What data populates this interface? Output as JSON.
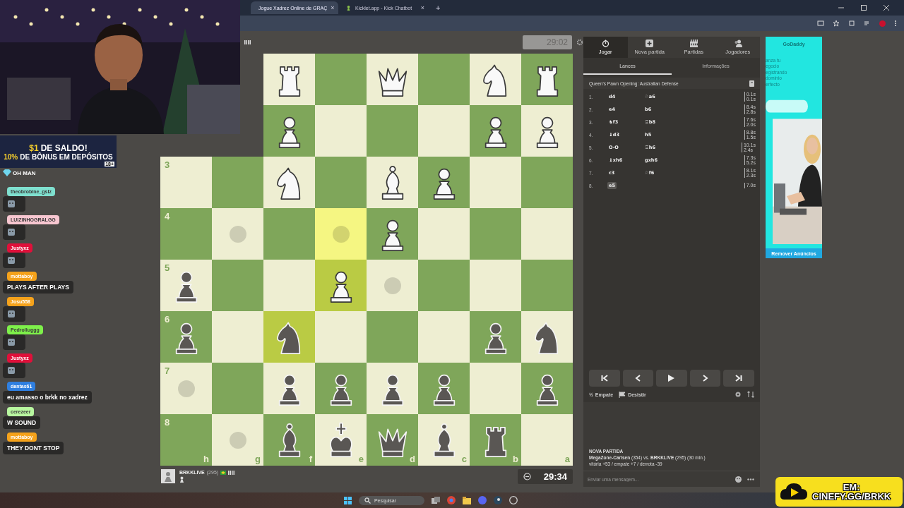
{
  "browser": {
    "tabs": [
      {
        "title": "Jogue Xadrez Online de GRAÇ",
        "selected": true,
        "close": "×"
      },
      {
        "title": "Kicklet.app - Kick Chatbot",
        "selected": false,
        "close": "×"
      }
    ],
    "new_tab": "+"
  },
  "board": {
    "clock": "29:02",
    "rows": [
      {
        "squares": [
          {
            "kind": "rook",
            "color": "#f9f9f9",
            "hint": false,
            "highlight": false
          },
          {
            "hint": false,
            "highlight": false
          },
          {
            "kind": "queen",
            "color": "#f9f9f9",
            "hint": false,
            "highlight": false
          },
          {
            "hint": false,
            "highlight": false
          },
          {
            "kind": "knight",
            "color": "#f9f9f9",
            "hint": false,
            "highlight": false
          },
          {
            "kind": "rook",
            "color": "#f9f9f9",
            "hint": false,
            "highlight": false
          }
        ]
      },
      {
        "squares": [
          {
            "kind": "pawn",
            "color": "#f9f9f9",
            "hint": false,
            "highlight": false
          },
          {
            "hint": false,
            "highlight": false
          },
          {
            "hint": false,
            "highlight": false
          },
          {
            "hint": false,
            "highlight": false
          },
          {
            "kind": "pawn",
            "color": "#f9f9f9",
            "hint": false,
            "highlight": false
          },
          {
            "kind": "pawn",
            "color": "#f9f9f9",
            "hint": false,
            "highlight": false
          }
        ]
      },
      {
        "squares": [
          {
            "rank_label": "3",
            "hint": false,
            "highlight": false
          },
          {
            "hint": false,
            "highlight": false
          },
          {
            "kind": "knight",
            "color": "#f9f9f9",
            "hint": false,
            "highlight": false
          },
          {
            "hint": false,
            "highlight": false
          },
          {
            "kind": "bishop",
            "color": "#f9f9f9",
            "hint": false,
            "highlight": false
          },
          {
            "kind": "pawn",
            "color": "#f9f9f9",
            "hint": false,
            "highlight": false
          },
          {
            "hint": false,
            "highlight": false
          },
          {
            "hint": false,
            "highlight": false
          }
        ]
      },
      {
        "squares": [
          {
            "rank_label": "4",
            "hint": false,
            "highlight": false
          },
          {
            "hint": true,
            "highlight": false
          },
          {
            "hint": false,
            "highlight": false
          },
          {
            "hint": true,
            "highlight": true
          },
          {
            "kind": "pawn",
            "color": "#f9f9f9",
            "hint": false,
            "highlight": false
          },
          {
            "hint": false,
            "highlight": false
          },
          {
            "hint": false,
            "highlight": false
          },
          {
            "hint": false,
            "highlight": false
          }
        ]
      },
      {
        "squares": [
          {
            "rank_label": "5",
            "kind": "pawn",
            "color": "#5a5754",
            "hint": false,
            "highlight": false
          },
          {
            "hint": false,
            "highlight": false
          },
          {
            "hint": false,
            "highlight": false
          },
          {
            "kind": "pawn",
            "color": "#f9f9f9",
            "hint": false,
            "highlight": true
          },
          {
            "hint": true,
            "highlight": false
          },
          {
            "hint": false,
            "highlight": false
          },
          {
            "hint": false,
            "highlight": false
          },
          {
            "hint": false,
            "highlight": false
          }
        ]
      },
      {
        "squares": [
          {
            "rank_label": "6",
            "kind": "pawn",
            "color": "#5a5754",
            "hint": false,
            "highlight": false
          },
          {
            "hint": false,
            "highlight": false
          },
          {
            "kind": "knight",
            "color": "#5a5754",
            "hint": false,
            "highlight": true
          },
          {
            "hint": false,
            "highlight": false
          },
          {
            "hint": false,
            "highlight": false
          },
          {
            "hint": false,
            "highlight": false
          },
          {
            "kind": "pawn",
            "color": "#5a5754",
            "hint": false,
            "highlight": false
          },
          {
            "kind": "knight",
            "color": "#5a5754",
            "hint": false,
            "highlight": false
          }
        ]
      },
      {
        "squares": [
          {
            "rank_label": "7",
            "hint": true,
            "highlight": false
          },
          {
            "hint": false,
            "highlight": false
          },
          {
            "kind": "pawn",
            "color": "#5a5754",
            "hint": false,
            "highlight": false
          },
          {
            "kind": "pawn",
            "color": "#5a5754",
            "hint": false,
            "highlight": false
          },
          {
            "kind": "pawn",
            "color": "#5a5754",
            "hint": false,
            "highlight": false
          },
          {
            "kind": "pawn",
            "color": "#5a5754",
            "hint": false,
            "highlight": false
          },
          {
            "hint": false,
            "highlight": false
          },
          {
            "kind": "pawn",
            "color": "#5a5754",
            "hint": false,
            "highlight": false
          }
        ]
      },
      {
        "squares": [
          {
            "rank_label": "8",
            "file_label": "h",
            "hint": false,
            "highlight": false
          },
          {
            "file_label": "g",
            "hint": true,
            "highlight": false
          },
          {
            "file_label": "f",
            "kind": "bishop",
            "color": "#5a5754",
            "hint": false,
            "highlight": false
          },
          {
            "file_label": "e",
            "kind": "king",
            "color": "#5a5754",
            "hint": false,
            "highlight": false
          },
          {
            "file_label": "d",
            "kind": "queen",
            "color": "#5a5754",
            "hint": false,
            "highlight": false
          },
          {
            "file_label": "c",
            "kind": "bishop",
            "color": "#5a5754",
            "hint": false,
            "highlight": false
          },
          {
            "file_label": "b",
            "kind": "rook",
            "color": "#5a5754",
            "hint": false,
            "highlight": false
          },
          {
            "file_label": "a",
            "hint": false,
            "highlight": false
          }
        ]
      }
    ],
    "player": {
      "name": "BRKKLIVE",
      "rating": "(295)",
      "clock": "29:34"
    }
  },
  "panel": {
    "nav": [
      {
        "label": "Jogar",
        "kind": "clock",
        "selected": true
      },
      {
        "label": "Nova partida",
        "kind": "plus",
        "selected": false
      },
      {
        "label": "Partidas",
        "kind": "grid",
        "selected": false
      },
      {
        "label": "Jogadores",
        "kind": "people",
        "selected": false
      }
    ],
    "subtabs": [
      {
        "label": "Lances",
        "selected": true
      },
      {
        "label": "Informações",
        "selected": false
      }
    ],
    "opening": "Queen's Pawn Opening: Australian Defense",
    "moves": [
      {
        "num": "1.",
        "white": {
          "san": "d4",
          "selected": false
        },
        "black": {
          "san": "♘a6",
          "selected": false
        },
        "times": [
          "0.1s",
          "0.1s"
        ]
      },
      {
        "num": "2.",
        "white": {
          "san": "e4",
          "selected": false
        },
        "black": {
          "san": "b6",
          "selected": false
        },
        "times": [
          "8.4s",
          "2.8s"
        ]
      },
      {
        "num": "3.",
        "white": {
          "san": "♞f3",
          "selected": false
        },
        "black": {
          "san": "♖b8",
          "selected": false
        },
        "times": [
          "7.6s",
          "2.0s"
        ]
      },
      {
        "num": "4.",
        "white": {
          "san": "♝d3",
          "selected": false
        },
        "black": {
          "san": "h5",
          "selected": false
        },
        "times": [
          "8.8s",
          "1.5s"
        ]
      },
      {
        "num": "5.",
        "white": {
          "san": "O-O",
          "selected": false
        },
        "black": {
          "san": "♖h6",
          "selected": false
        },
        "times": [
          "10.1s",
          "2.4s"
        ]
      },
      {
        "num": "6.",
        "white": {
          "san": "♝xh6",
          "selected": false
        },
        "black": {
          "san": "gxh6",
          "selected": false
        },
        "times": [
          "7.3s",
          "5.2s"
        ]
      },
      {
        "num": "7.",
        "white": {
          "san": "c3",
          "selected": false
        },
        "black": {
          "san": "♘f6",
          "selected": false
        },
        "times": [
          "8.1s",
          "2.3s"
        ]
      },
      {
        "num": "8.",
        "white": {
          "san": "e5",
          "selected": true
        },
        "times": [
          "7.0s"
        ]
      }
    ],
    "controls": [
      {
        "kind": "first"
      },
      {
        "kind": "prev"
      },
      {
        "kind": "play"
      },
      {
        "kind": "next"
      },
      {
        "kind": "last"
      }
    ],
    "draw": {
      "icon": "½",
      "label": "Empate"
    },
    "resign": {
      "label": "Desistir"
    },
    "chat": {
      "title": "NOVA PARTIDA",
      "line": "**MegaZone-Carlsen** (354) vs. **BRKKLIVE** (295) (30 min.)",
      "score": "vitória +53 / empate +7 / derrota -39",
      "placeholder": "Enviar uma mensagem..."
    }
  },
  "ad": {
    "brand": "GoDaddy",
    "lines": [
      "anza tu",
      "egocio",
      "egistrando",
      "dominio",
      "erfecto"
    ],
    "button": "Remover Anúncios"
  },
  "overlay": {
    "promo": {
      "amount": "$1",
      "headline": "DE SALDO!",
      "bonus_pct": "10%",
      "bonus_text": "DE BÔNUS EM DEPÓSITOS",
      "age": "18+"
    },
    "chat": [
      {
        "kind": "system",
        "text": "OH MAN"
      },
      {
        "kind": "emote",
        "user": "theobrobine_gslz",
        "color": "#7fe0cf"
      },
      {
        "kind": "emote",
        "user": "LUIZINHOGRALGG",
        "color": "#f7c6d0"
      },
      {
        "kind": "emote",
        "user": "Justyxz",
        "color": "#e0103a"
      },
      {
        "kind": "text",
        "user": "mottaboy",
        "color": "#f5a21b",
        "text": "PLAYS AFTER PLAYS"
      },
      {
        "kind": "emote",
        "user": "Josu558",
        "color": "#f5a21b"
      },
      {
        "kind": "emote",
        "user": "Pedrolluggg",
        "color": "#7ef04a"
      },
      {
        "kind": "emote",
        "user": "Justyxz",
        "color": "#e0103a"
      },
      {
        "kind": "text",
        "user": "dantas61",
        "color": "#2f7fe0",
        "text": "eu amasso o brkk no xadrez"
      },
      {
        "kind": "text",
        "user": "cerezeer",
        "color": "#b8f7a0",
        "text": "W SOUND"
      },
      {
        "kind": "text",
        "user": "mottaboy",
        "color": "#f5a21b",
        "text": "THEY DONT STOP"
      }
    ],
    "banner": {
      "top": "EM:",
      "bottom": "CINEFY.GG/BRKK"
    }
  },
  "taskbar": {
    "search": "Pesquisar"
  }
}
